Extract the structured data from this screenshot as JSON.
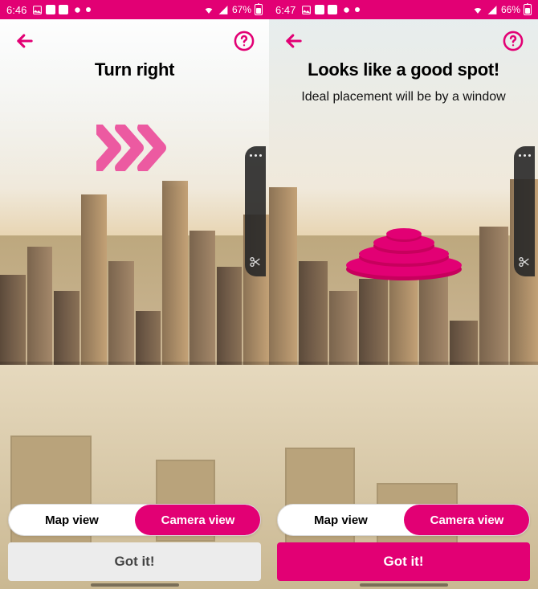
{
  "colors": {
    "brand": "#e20074"
  },
  "status_icons": [
    "image-icon",
    "app-w-icon",
    "app-m-icon",
    "reddit-icon",
    "dot-icon"
  ],
  "right_icons": [
    "wifi-icon",
    "signal-icon"
  ],
  "screens": [
    {
      "status": {
        "time": "6:46",
        "battery": "67%"
      },
      "title": "Turn right",
      "subtitle": "",
      "overlay": "chevrons",
      "toggle": {
        "map": "Map view",
        "camera": "Camera view",
        "active": "camera"
      },
      "cta": {
        "label": "Got it!",
        "variant": "light"
      }
    },
    {
      "status": {
        "time": "6:47",
        "battery": "66%"
      },
      "title": "Looks like a good spot!",
      "subtitle": "Ideal placement will be by a window",
      "overlay": "signal-disc",
      "toggle": {
        "map": "Map view",
        "camera": "Camera view",
        "active": "camera"
      },
      "cta": {
        "label": "Got it!",
        "variant": "dark"
      }
    }
  ]
}
